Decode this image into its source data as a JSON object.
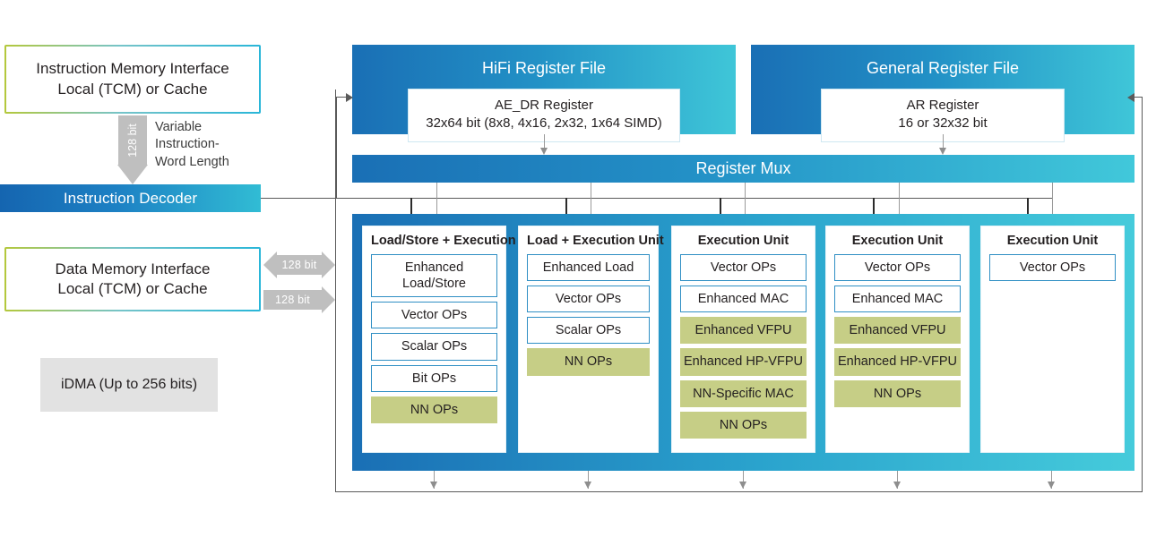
{
  "diagram": {
    "title": "HiFi DSP Architecture Block Diagram",
    "colors": {
      "blue_dark": "#1a6fb5",
      "cyan": "#41c8da",
      "olive_green": "#c6ce86",
      "border_blue": "#2f8fc4",
      "gray_arrow": "#bfbfbf",
      "idma_gray": "#e2e2e2",
      "gradient_border_start": "#b4c83c",
      "gradient_border_end": "#29b6d8"
    }
  },
  "left_column": {
    "instruction_memory": {
      "line1": "Instruction Memory Interface",
      "line2": "Local (TCM) or Cache"
    },
    "instruction_bus": {
      "bit_label": "128 bit",
      "note_line1": "Variable",
      "note_line2": "Instruction-",
      "note_line3": "Word Length"
    },
    "instruction_decoder": {
      "label": "Instruction Decoder"
    },
    "data_memory": {
      "line1": "Data Memory Interface",
      "line2": "Local (TCM) or Cache"
    },
    "data_bus_arrows": [
      {
        "label": "128 bit",
        "direction": "bidirectional"
      },
      {
        "label": "128 bit",
        "direction": "right"
      }
    ],
    "idma": {
      "line1": "iDMA",
      "line2": "(Up to 256 bits)"
    }
  },
  "register_files": [
    {
      "title": "HiFi Register File",
      "inner_line1": "AE_DR Register",
      "inner_line2": "32x64 bit (8x8, 4x16, 2x32, 1x64 SIMD)"
    },
    {
      "title": "General Register File",
      "inner_line1": "AR Register",
      "inner_line2": "16 or 32x32 bit"
    }
  ],
  "register_mux": {
    "label": "Register Mux"
  },
  "execution_units": [
    {
      "title": "Load/Store + Execution",
      "ops": [
        {
          "label": "Enhanced Load/Store",
          "line1": "Enhanced",
          "line2": "Load/Store",
          "style": "blue",
          "lines": 2
        },
        {
          "label": "Vector OPs",
          "style": "blue",
          "lines": 1
        },
        {
          "label": "Scalar OPs",
          "style": "blue",
          "lines": 1
        },
        {
          "label": "Bit OPs",
          "style": "blue",
          "lines": 1
        },
        {
          "label": "NN OPs",
          "style": "green",
          "lines": 1
        }
      ]
    },
    {
      "title": "Load + Execution Unit",
      "ops": [
        {
          "label": "Enhanced Load",
          "style": "blue",
          "lines": 1
        },
        {
          "label": "Vector OPs",
          "style": "blue",
          "lines": 1
        },
        {
          "label": "Scalar OPs",
          "style": "blue",
          "lines": 1
        },
        {
          "label": "NN OPs",
          "style": "green",
          "lines": 1
        }
      ]
    },
    {
      "title": "Execution Unit",
      "ops": [
        {
          "label": "Vector OPs",
          "style": "blue",
          "lines": 1
        },
        {
          "label": "Enhanced MAC",
          "style": "blue",
          "lines": 1
        },
        {
          "label": "Enhanced VFPU",
          "style": "green",
          "lines": 1
        },
        {
          "label": "Enhanced HP-VFPU",
          "style": "green",
          "lines": 1
        },
        {
          "label": "NN-Specific MAC",
          "style": "green",
          "lines": 1
        },
        {
          "label": "NN OPs",
          "style": "green",
          "lines": 1
        }
      ]
    },
    {
      "title": "Execution Unit",
      "ops": [
        {
          "label": "Vector OPs",
          "style": "blue",
          "lines": 1
        },
        {
          "label": "Enhanced MAC",
          "style": "blue",
          "lines": 1
        },
        {
          "label": "Enhanced VFPU",
          "style": "green",
          "lines": 1
        },
        {
          "label": "Enhanced HP-VFPU",
          "style": "green",
          "lines": 1
        },
        {
          "label": "NN OPs",
          "style": "green",
          "lines": 1
        }
      ]
    },
    {
      "title": "Execution Unit",
      "ops": [
        {
          "label": "Vector OPs",
          "style": "blue",
          "lines": 1
        }
      ]
    }
  ]
}
